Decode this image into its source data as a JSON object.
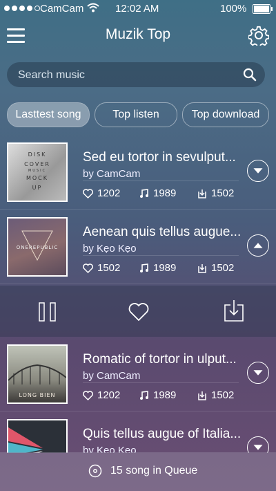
{
  "status": {
    "carrier": "CamCam",
    "time": "12:02 AM",
    "battery": "100%"
  },
  "header": {
    "title": "Muzik Top"
  },
  "search": {
    "placeholder": "Search music"
  },
  "tabs": [
    {
      "label": "Lasttest song",
      "active": true
    },
    {
      "label": "Top listen",
      "active": false
    },
    {
      "label": "Top download",
      "active": false
    }
  ],
  "songs": [
    {
      "title": "Sed eu tortor in sevulput...",
      "artist": "by CamCam",
      "likes": "1202",
      "plays": "1989",
      "downloads": "1502",
      "cover_text": [
        "DISK",
        "COVER",
        "MUSIC",
        "MOCK",
        "UP"
      ],
      "expanded": false
    },
    {
      "title": "Aenean quis tellus augue...",
      "artist": "by Kẹo Kẹo",
      "likes": "1502",
      "plays": "1989",
      "downloads": "1502",
      "cover_text": [
        "ONEREPUBLIC"
      ],
      "expanded": true
    },
    {
      "title": "Romatic of tortor in ulput...",
      "artist": "by CamCam",
      "likes": "1202",
      "plays": "1989",
      "downloads": "1502",
      "cover_text": [
        "LONG BIEN"
      ],
      "expanded": false
    },
    {
      "title": "Quis tellus augue of Italia...",
      "artist": "by Kẹo Kẹo",
      "likes": "",
      "plays": "",
      "downloads": "",
      "cover_text": [],
      "expanded": false
    }
  ],
  "queue": {
    "label": "15 song in Queue"
  },
  "icons": [
    "menu-icon",
    "gear-icon",
    "search-icon",
    "heart-icon",
    "music-note-icon",
    "download-icon",
    "chevron-down-icon",
    "chevron-up-icon",
    "pause-icon",
    "disc-icon"
  ]
}
